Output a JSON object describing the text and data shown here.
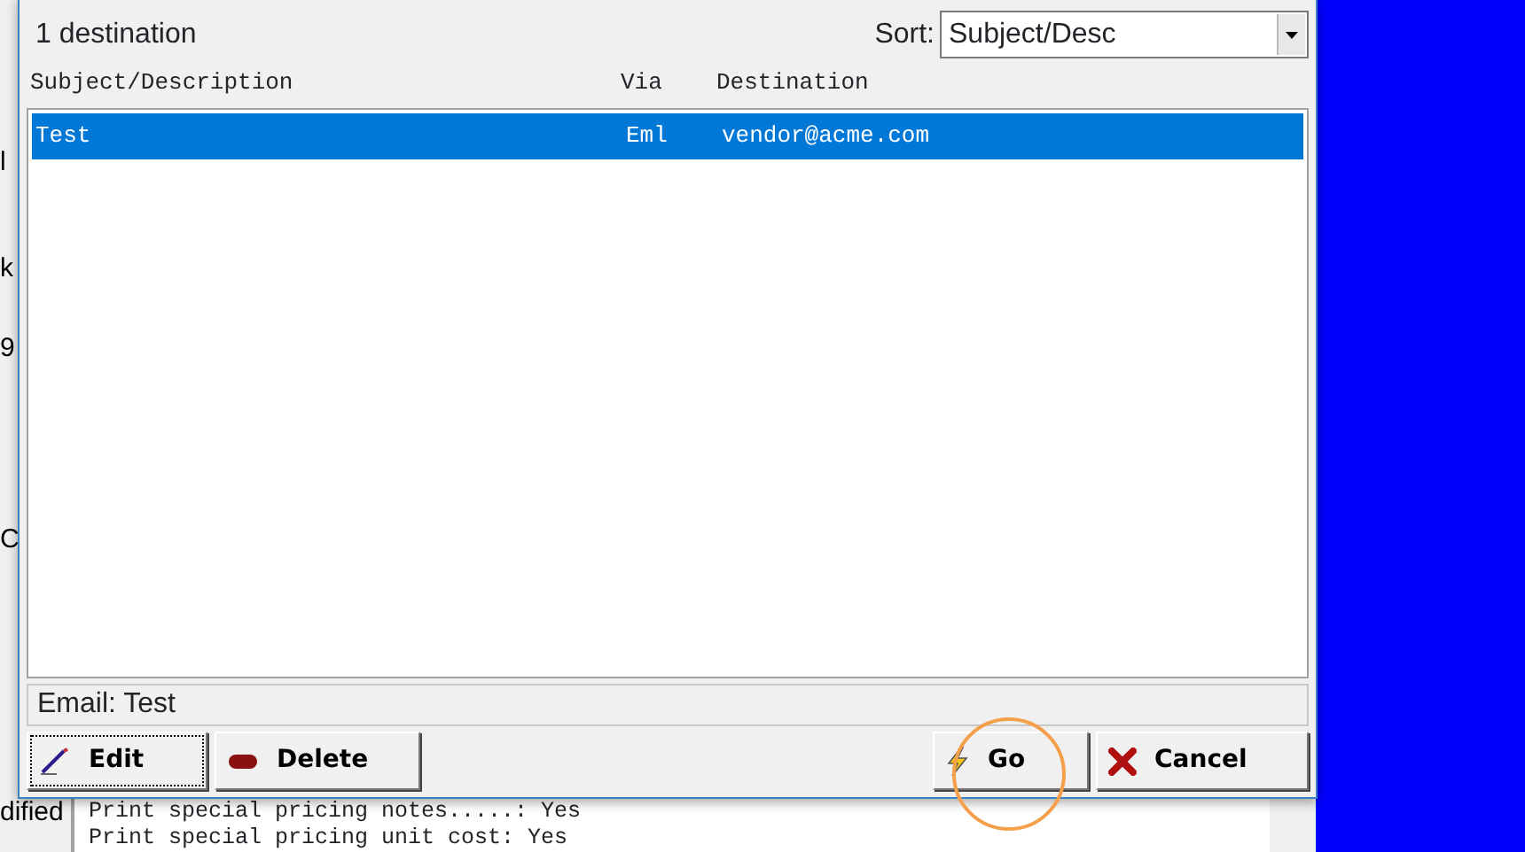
{
  "dialog": {
    "count_label": "1 destination",
    "sort": {
      "label": "Sort:",
      "value": "Subject/Desc"
    },
    "columns": [
      "Subject/Description",
      "Via",
      "Destination"
    ],
    "rows": [
      {
        "cells": [
          "Test",
          "Eml",
          "vendor@acme.com"
        ],
        "selected": true
      }
    ],
    "status": "Email: Test",
    "buttons": [
      {
        "label": "Edit",
        "kind": "edit",
        "focused": true,
        "highlighted": false
      },
      {
        "label": "Delete",
        "kind": "delete",
        "focused": false,
        "highlighted": false
      },
      {
        "label": "Go",
        "kind": "go",
        "focused": false,
        "highlighted": true
      },
      {
        "label": "Cancel",
        "kind": "cancel",
        "focused": false,
        "highlighted": false
      }
    ]
  },
  "background": {
    "edge_texts": [
      "l",
      "k",
      "9",
      "C",
      "dified"
    ],
    "lines": [
      "Print special pricing notes.....: Yes",
      "Print special pricing unit cost: Yes"
    ]
  }
}
